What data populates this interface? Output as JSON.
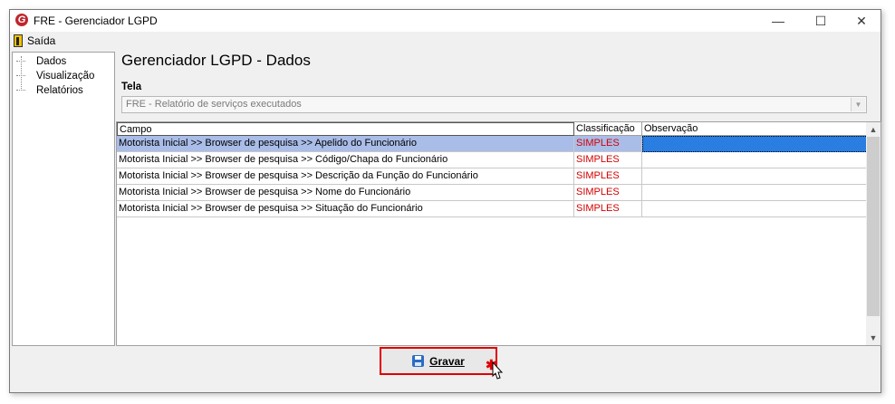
{
  "window": {
    "title": "FRE - Gerenciador LGPD",
    "logo_letter": "G",
    "controls": {
      "minimize": "—",
      "maximize": "☐",
      "close": "✕"
    }
  },
  "menu": {
    "exit_label": "Saída",
    "exit_icon": "exit-door-icon"
  },
  "tree": {
    "items": [
      "Dados",
      "Visualização",
      "Relatórios"
    ]
  },
  "main": {
    "title": "Gerenciador LGPD - Dados",
    "tela_label": "Tela",
    "tela_value": "FRE - Relatório de serviços executados"
  },
  "grid": {
    "columns": [
      "Campo",
      "Classificação",
      "Observação"
    ],
    "rows": [
      {
        "campo": "Motorista Inicial >> Browser de pesquisa >> Apelido do Funcionário",
        "classificacao": "SIMPLES",
        "observacao": ""
      },
      {
        "campo": "Motorista Inicial >> Browser de pesquisa >> Código/Chapa do Funcionário",
        "classificacao": "SIMPLES",
        "observacao": ""
      },
      {
        "campo": "Motorista Inicial >> Browser de pesquisa >> Descrição da Função do Funcionário",
        "classificacao": "SIMPLES",
        "observacao": ""
      },
      {
        "campo": "Motorista Inicial >> Browser de pesquisa >> Nome do Funcionário",
        "classificacao": "SIMPLES",
        "observacao": ""
      },
      {
        "campo": "Motorista Inicial >> Browser de pesquisa >> Situação do Funcionário",
        "classificacao": "SIMPLES",
        "observacao": ""
      }
    ],
    "selected_row": 0
  },
  "footer": {
    "save_label": "Gravar"
  },
  "colors": {
    "accent_red": "#e00000",
    "selection": "#a9bde8",
    "focus_cell": "#2a7de1",
    "classification_text": "#d40000"
  }
}
